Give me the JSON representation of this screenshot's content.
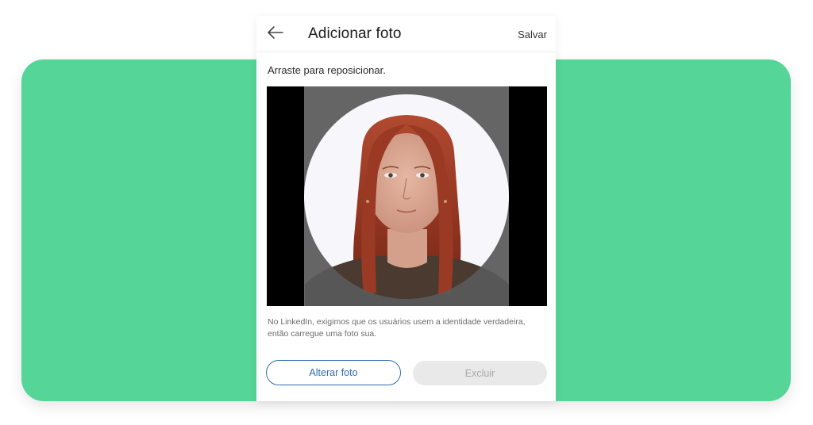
{
  "dialog": {
    "title": "Adicionar foto",
    "save_label": "Salvar",
    "instruction": "Arraste para reposicionar.",
    "info_line1": "No LinkedIn, exigimos que os usuários usem a identidade verdadeira,",
    "info_line2": "então carregue uma foto sua.",
    "change_photo_label": "Alterar foto",
    "delete_label": "Excluir"
  },
  "icons": {
    "back": "arrow-left-icon"
  },
  "colors": {
    "background_accent": "#56d598",
    "primary_blue": "#2f6cb1",
    "disabled_bg": "#e9e9e9",
    "disabled_text": "#a8a8a8"
  }
}
